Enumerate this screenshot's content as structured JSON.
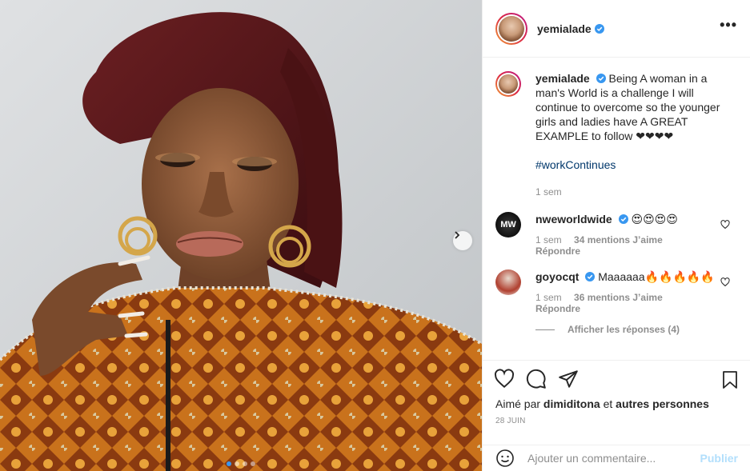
{
  "post": {
    "author": "yemialade",
    "more_label": "•••",
    "caption": "Being A woman in a man's World is a challenge I will continue to overcome so the younger girls and ladies have A GREAT EXAMPLE to follow ❤❤❤❤",
    "hashtag": "#workContinues",
    "caption_time": "1 sem",
    "carousel": {
      "slides": 4,
      "active_index": 0
    }
  },
  "comments": [
    {
      "user": "nweworldwide",
      "text": "😍😍😍😍",
      "time": "1 sem",
      "likes": "34 mentions J’aime",
      "reply": "Répondre"
    },
    {
      "user": "goyocqt",
      "text": "Maaaaaa🔥🔥🔥🔥🔥",
      "time": "1 sem",
      "likes": "36 mentions J’aime",
      "reply": "Répondre"
    }
  ],
  "view_replies": "Afficher les réponses (4)",
  "liked_by": {
    "prefix": "Aimé par",
    "user": "dimiditona",
    "mid": "et",
    "others": "autres personnes"
  },
  "date": "28 JUIN",
  "add_comment": {
    "placeholder": "Ajouter un commentaire...",
    "publish": "Publier"
  },
  "colors": {
    "verified": "#3897f0",
    "link": "#00376b",
    "muted": "#8e8e8e",
    "publish_disabled": "#b2dffc"
  }
}
